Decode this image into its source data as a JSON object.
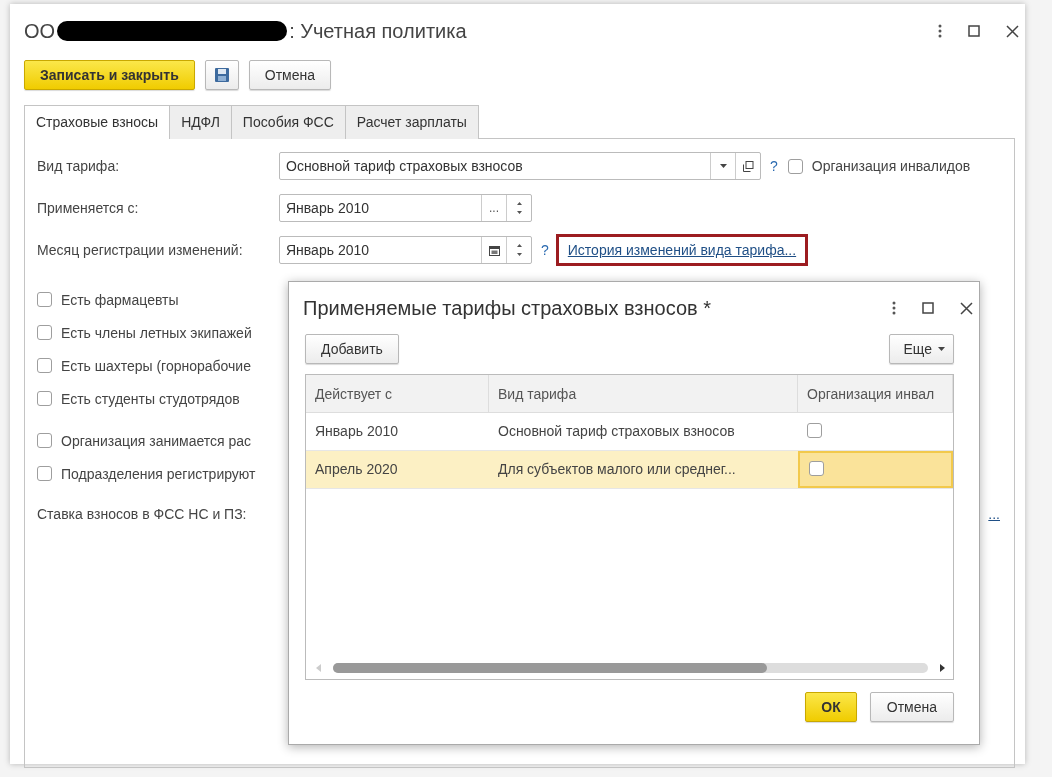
{
  "window": {
    "title_prefix": "ОО",
    "title_suffix": ": Учетная политика"
  },
  "toolbar": {
    "save_close": "Записать и закрыть",
    "cancel": "Отмена"
  },
  "tabs": [
    {
      "label": "Страховые взносы",
      "selected": true
    },
    {
      "label": "НДФЛ",
      "selected": false
    },
    {
      "label": "Пособия ФСС",
      "selected": false
    },
    {
      "label": "Расчет зарплаты",
      "selected": false
    }
  ],
  "form": {
    "tariff": {
      "label": "Вид тарифа:",
      "value": "Основной тариф страховых взносов",
      "help": "?"
    },
    "disabled_org": {
      "label": "Организация инвалидов",
      "checked": false
    },
    "applies_from": {
      "label": "Применяется с:",
      "value": "Январь 2010",
      "button": "..."
    },
    "reg_month": {
      "label": "Месяц регистрации изменений:",
      "value": "Январь 2010",
      "help": "?"
    },
    "history_link": "История изменений вида тарифа...",
    "checkboxes": [
      {
        "label": "Есть фармацевты",
        "checked": false
      },
      {
        "label": "Есть члены летных экипажей",
        "checked": false
      },
      {
        "label": "Есть шахтеры (горнорабочие",
        "checked": false
      },
      {
        "label": "Есть студенты студотрядов",
        "checked": false
      },
      {
        "label": "Организация занимается рас",
        "checked": false
      },
      {
        "label": "Подразделения регистрируют",
        "checked": false
      }
    ],
    "rate_label": "Ставка взносов в ФСС НС и ПЗ:",
    "rate_link": "..."
  },
  "dialog": {
    "title": "Применяемые тарифы страховых взносов *",
    "add": "Добавить",
    "more": "Еще",
    "columns": [
      "Действует с",
      "Вид тарифа",
      "Организация инвал"
    ],
    "rows": [
      {
        "date": "Январь 2010",
        "tariff": "Основной тариф страховых взносов",
        "disabled_org": false,
        "selected": false
      },
      {
        "date": "Апрель 2020",
        "tariff": "Для субъектов малого или среднег...",
        "disabled_org": false,
        "selected": true
      }
    ],
    "ok": "ОК",
    "cancel": "Отмена"
  }
}
